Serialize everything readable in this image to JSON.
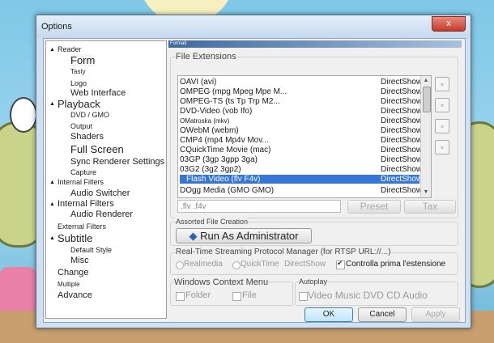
{
  "dialog": {
    "title": "Options",
    "close_label": "x"
  },
  "tree": {
    "items": [
      {
        "label": "Reader",
        "toggle": "▲"
      },
      {
        "label": "Form"
      },
      {
        "label": "Tasty"
      },
      {
        "label": "Logo"
      },
      {
        "label": "Web Interface"
      },
      {
        "label": "Playback",
        "toggle": "▲"
      },
      {
        "label": "DVD / GMO"
      },
      {
        "label": "Output"
      },
      {
        "label": "Shaders"
      },
      {
        "label": "Full Screen"
      },
      {
        "label": "Sync Renderer Settings"
      },
      {
        "label": "Capture"
      },
      {
        "label": "Internal Filters",
        "toggle": "▲"
      },
      {
        "label": "Audio Switcher"
      },
      {
        "label": "Internal Filters",
        "toggle": "▲"
      },
      {
        "label": "Audio Renderer"
      },
      {
        "label": "External Filters"
      },
      {
        "label": "Subtitle",
        "toggle": "▲"
      },
      {
        "label": "Default Style"
      },
      {
        "label": "Misc"
      },
      {
        "label": "Change"
      },
      {
        "label": "Multiple"
      },
      {
        "label": "Advance"
      }
    ]
  },
  "pane": {
    "title": "Formati"
  },
  "extensions": {
    "group_label": "File Extensions",
    "rows": [
      {
        "name": "OAVI (avi)",
        "value": "DirectShow"
      },
      {
        "name": "OMPEG (mpg Mpeg Mpe M...",
        "value": "DirectShow"
      },
      {
        "name": "OMPEG-TS (ts Tp Trp M2...",
        "value": "DirectShow"
      },
      {
        "name": "DVD-Video (vob Ifo)",
        "value": "DirectShow"
      },
      {
        "name": "OMatroska (mkv)",
        "value": "DirectShow"
      },
      {
        "name": "OWebM (webm)",
        "value": "DirectShow"
      },
      {
        "name": "CMP4 (mp4 Mp4v Mov...",
        "value": "DirectShow"
      },
      {
        "name": "CQuickTime Movie (mac)",
        "value": "DirectShow"
      },
      {
        "name": "03GP (3gp 3gpp 3ga)",
        "value": "DirectShow"
      },
      {
        "name": "03G2 (3g2 3gp2)",
        "value": "DirectShow"
      },
      {
        "name": "Flash Video (flv F4v)",
        "value": "DirectShow"
      },
      {
        "name": "DOgg Media (GMO GMO)",
        "value": "DirectShow"
      }
    ],
    "ext_value": ".flv .f4v",
    "preset_label": "Preset",
    "tax_label": "Tax"
  },
  "file_creation": {
    "group_label": "Assorted File Creation",
    "run_admin_label": "Run As Administrator"
  },
  "rtsp": {
    "group_label": "Real-Time Streaming Protocol Manager (for RTSP URL://...)",
    "opt_realmedia": "Realmedia",
    "opt_quicktime": "QuickTime",
    "opt_directshow": "DirectShow",
    "check_label": "Controlla prima l'estensione"
  },
  "context_menu": {
    "group_label": "Windows Context Menu",
    "folder_label": "Folder",
    "file_label": "File"
  },
  "autoplay": {
    "group_label": "Autoplay",
    "items": "Video Music DVD CD Audio"
  },
  "buttons": {
    "ok": "OK",
    "cancel": "Cancel",
    "apply": "Apply"
  }
}
